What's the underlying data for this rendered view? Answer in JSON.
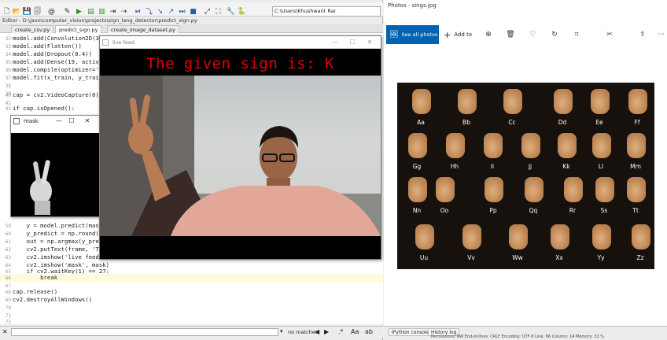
{
  "spyder": {
    "path_value": "C:\\Users\\Khushwant Rar",
    "editor_path": "Editor - D:\\javo\\computer_vision\\projects\\sign_lang_detector\\predict_sign.py",
    "tabs": [
      "create_csv.py",
      "predict_sign.py",
      "create_image_dataset.py"
    ],
    "code_lines": [
      {
        "n": "32",
        "text": "model.add(Convolution2D(32,"
      },
      {
        "n": "33",
        "text": "model.add(Flatten())"
      },
      {
        "n": "34",
        "text": "model.add(Dropout(0.4))"
      },
      {
        "n": "35",
        "text": "model.add(Dense(19, activat"
      },
      {
        "n": "36",
        "text": "model.compile(optimizer='ad"
      },
      {
        "n": "37",
        "text": "model.fit(x_train, y_train,"
      },
      {
        "n": "38",
        "text": ""
      },
      {
        "n": "39",
        "text": ""
      },
      {
        "n": "40",
        "text": "cap = cv2.VideoCapture(0)"
      },
      {
        "n": "41",
        "text": ""
      },
      {
        "n": "42",
        "text": "if cap.isOpened():"
      }
    ],
    "code_lines_lower": [
      {
        "n": "59",
        "text": "    y = model.predict(mask_"
      },
      {
        "n": "60",
        "text": "    y_predict = np.round(y)"
      },
      {
        "n": "61",
        "text": "    out = np.argmax(y_predi"
      },
      {
        "n": "62",
        "text": "    cv2.putText(frame, 'The"
      },
      {
        "n": "63",
        "text": "    cv2.imshow('live feed',"
      },
      {
        "n": "64",
        "text": "    cv2.imshow('mask', mask)"
      },
      {
        "n": "65",
        "text": "    if cv2.waitKey(1) == 27:"
      },
      {
        "n": "66",
        "text": "        break"
      },
      {
        "n": "67",
        "text": ""
      },
      {
        "n": "68",
        "text": "cap.release()"
      },
      {
        "n": "69",
        "text": "cv2.destroyAllWindows()"
      },
      {
        "n": "70",
        "text": ""
      },
      {
        "n": "71",
        "text": ""
      },
      {
        "n": "72",
        "text": ""
      }
    ],
    "find_status": "no matches"
  },
  "mask_window": {
    "title": "mask",
    "minimize": "—",
    "maximize": "☐",
    "close": "✕"
  },
  "feed_window": {
    "title": "live feed",
    "caption": "The given sign is: K"
  },
  "photos": {
    "title": "Photos - sings.jpg",
    "see_all": "See all photos",
    "add_to": "Add to",
    "rows": [
      [
        "Aa",
        "Bb",
        "Cc",
        "Dd",
        "Ee",
        "Ff"
      ],
      [
        "Gg",
        "Hh",
        "Ii",
        "Jj",
        "Kk",
        "Ll",
        "Mm"
      ],
      [
        "Nn",
        "Oo",
        "Pp",
        "Qq",
        "Rr",
        "Ss",
        "Tt"
      ],
      [
        "Uu",
        "Vv",
        "Ww",
        "Xx",
        "Yy",
        "Zz"
      ]
    ]
  },
  "console": {
    "tab1": "IPython console",
    "tab2": "History log"
  },
  "status": "Permissions: RW   End-of-lines: CRLF   Encoding: UTF-8   Line: 66   Column: 14   Memory: 32 %"
}
